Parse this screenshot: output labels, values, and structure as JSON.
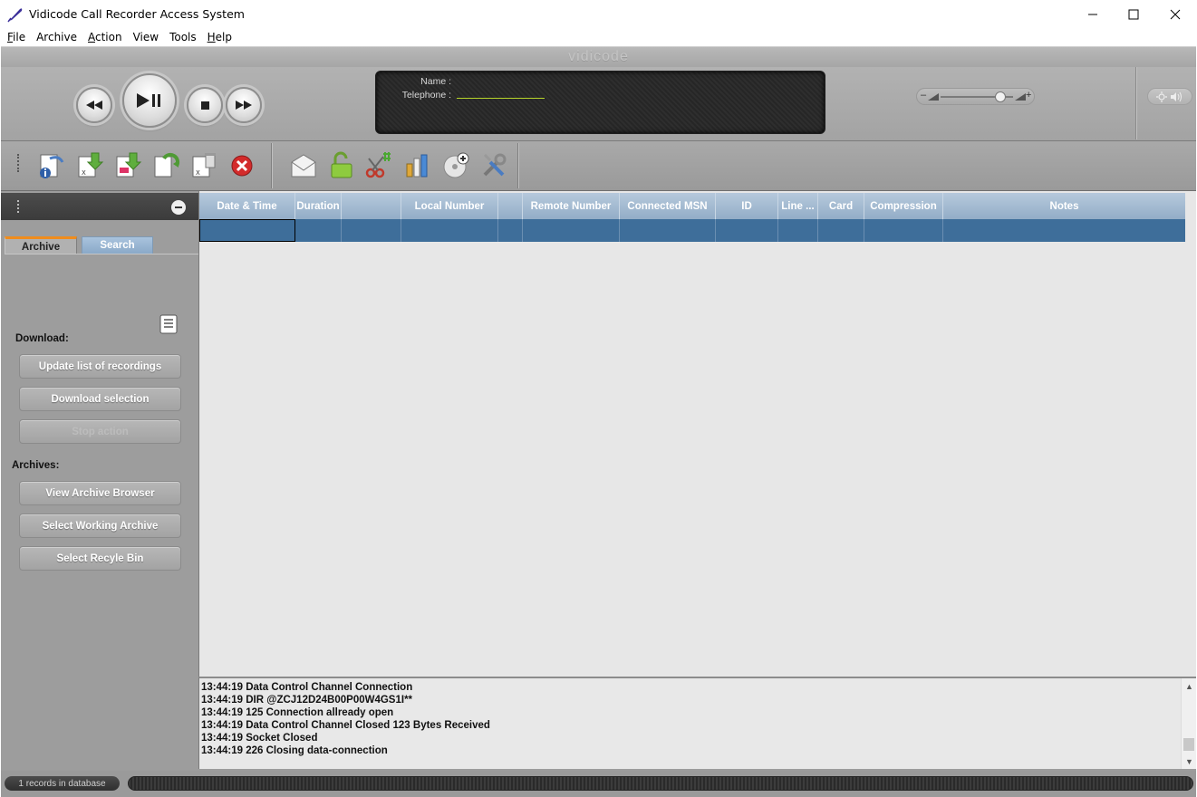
{
  "window": {
    "title": "Vidicode Call Recorder Access System",
    "icon": "feather-pen-icon"
  },
  "menu": [
    {
      "label": "File",
      "mnemonic": "F",
      "rest": "ile"
    },
    {
      "label": "Archive",
      "mnemonic": "",
      "rest": "Archive"
    },
    {
      "label": "Action",
      "mnemonic": "A",
      "rest": "ction"
    },
    {
      "label": "View",
      "mnemonic": "",
      "rest": "View"
    },
    {
      "label": "Tools",
      "mnemonic": "",
      "rest": "Tools"
    },
    {
      "label": "Help",
      "mnemonic": "H",
      "rest": "elp"
    }
  ],
  "brand": "vidicode",
  "player": {
    "name_label": "Name :",
    "name_value": "",
    "telephone_label": "Telephone :",
    "telephone_value": "",
    "volume_level": 0.83,
    "volume_minus": "–",
    "volume_plus": "+"
  },
  "toolbar": {
    "icons": [
      "document-info-icon",
      "excel-download-icon",
      "document-download-icon",
      "document-refresh-icon",
      "excel-delete-icon",
      "cancel-icon",
      "email-icon",
      "unlock-icon",
      "cut-icon",
      "chart-icon",
      "cd-burn-icon",
      "tools-icon"
    ]
  },
  "left_panel": {
    "tabs": {
      "archive": "Archive",
      "search": "Search"
    },
    "download_label": "Download:",
    "buttons_download": [
      {
        "label": "Update list of recordings",
        "enabled": true
      },
      {
        "label": "Download selection",
        "enabled": true
      },
      {
        "label": "Stop action",
        "enabled": false
      }
    ],
    "archives_label": "Archives:",
    "buttons_archives": [
      {
        "label": "View Archive Browser"
      },
      {
        "label": "Select Working Archive"
      },
      {
        "label": "Select Recyle Bin"
      }
    ]
  },
  "table": {
    "columns": [
      "Date & Time",
      "Duration",
      "",
      "Local Number",
      "",
      "Remote Number",
      "Connected MSN",
      "ID",
      "Line ...",
      "Card",
      "Compression",
      "Notes"
    ],
    "rows": [
      [
        "",
        "",
        "",
        "",
        "",
        "",
        "",
        "",
        "",
        "",
        "",
        ""
      ]
    ]
  },
  "log": [
    "13:44:19 Data Control Channel Connection",
    "13:44:19 DIR @ZCJ12D24B00P00W4GS1I**",
    "13:44:19 125 Connection allready open",
    "13:44:19 Data Control Channel Closed 123 Bytes Received",
    "13:44:19 Socket Closed",
    "13:44:19 226 Closing data-connection"
  ],
  "status": {
    "records_text": "1 records in database"
  }
}
